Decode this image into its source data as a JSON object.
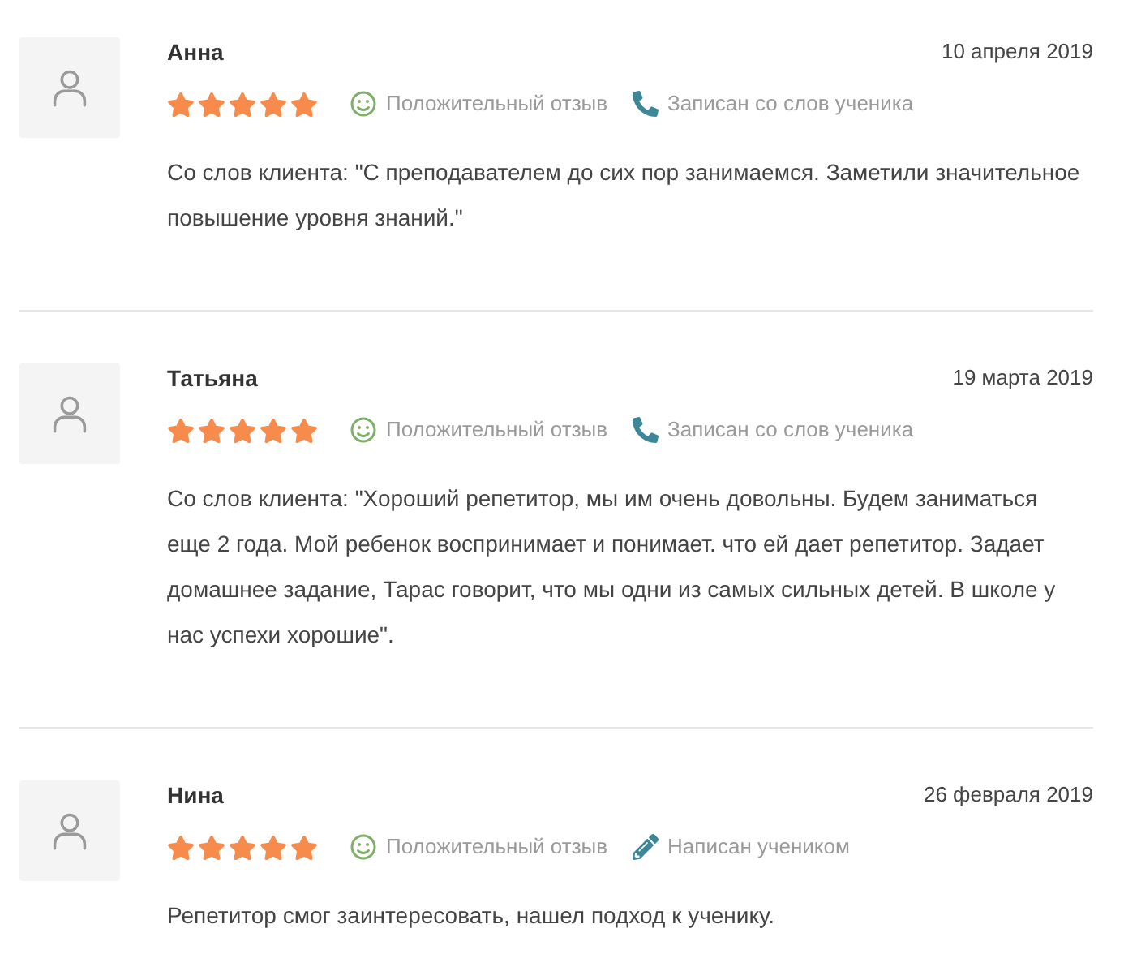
{
  "reviews": [
    {
      "name": "Анна",
      "date": "10 апреля 2019",
      "stars": 5,
      "sentiment": {
        "kind": "positive",
        "label": "Положительный отзыв"
      },
      "source": {
        "kind": "phone",
        "label": "Записан со слов ученика"
      },
      "text": "Со слов клиента: \"С преподавателем до сих пор занимаемся. Заметили значительное повышение уровня знаний.\""
    },
    {
      "name": "Татьяна",
      "date": "19 марта 2019",
      "stars": 5,
      "sentiment": {
        "kind": "positive",
        "label": "Положительный отзыв"
      },
      "source": {
        "kind": "phone",
        "label": "Записан со слов ученика"
      },
      "text": "Со слов клиента: \"Хороший репетитор, мы им очень довольны. Будем заниматься еще 2 года. Мой ребенок воспринимает и понимает. что ей дает репетитор. Задает домашнее задание, Тарас говорит, что мы одни из самых сильных детей. В школе у нас успехи хорошие\"."
    },
    {
      "name": "Нина",
      "date": "26 февраля 2019",
      "stars": 5,
      "sentiment": {
        "kind": "positive",
        "label": "Положительный отзыв"
      },
      "source": {
        "kind": "pencil",
        "label": "Написан учеником"
      },
      "text": "Репетитор смог заинтересовать, нашел подход к ученику."
    }
  ]
}
